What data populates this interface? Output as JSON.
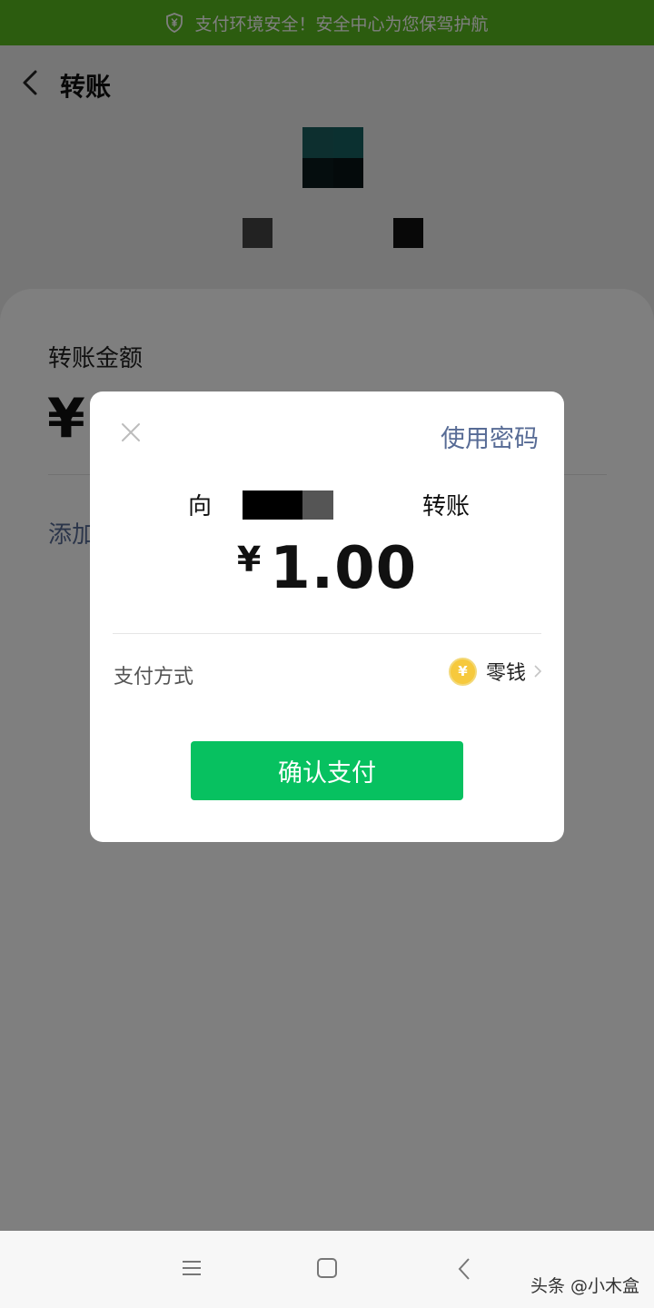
{
  "banner": {
    "text": "支付环境安全！安全中心为您保驾护航",
    "icon": "shield-yuan-icon"
  },
  "header": {
    "title": "转账",
    "back_icon": "chevron-left-icon"
  },
  "card": {
    "amount_label": "转账金额",
    "currency_symbol": "¥",
    "add_note_label": "添加"
  },
  "dialog": {
    "close_icon": "close-icon",
    "use_password_label": "使用密码",
    "to_prefix": "向",
    "to_suffix": "转账",
    "amount_currency": "¥",
    "amount_value": "1.00",
    "pay_method_label": "支付方式",
    "pay_method_coin": "¥",
    "pay_method_value": "零钱",
    "confirm_label": "确认支付"
  },
  "navbar": {
    "menu_icon": "menu-icon",
    "home_icon": "home-square-icon",
    "back_icon": "back-triangle-icon",
    "watermark": "头条 @小木盒"
  },
  "colors": {
    "banner_green": "#59b81f",
    "wechat_green": "#07c160",
    "link_blue": "#576b95",
    "coin_yellow": "#f6c93d"
  }
}
